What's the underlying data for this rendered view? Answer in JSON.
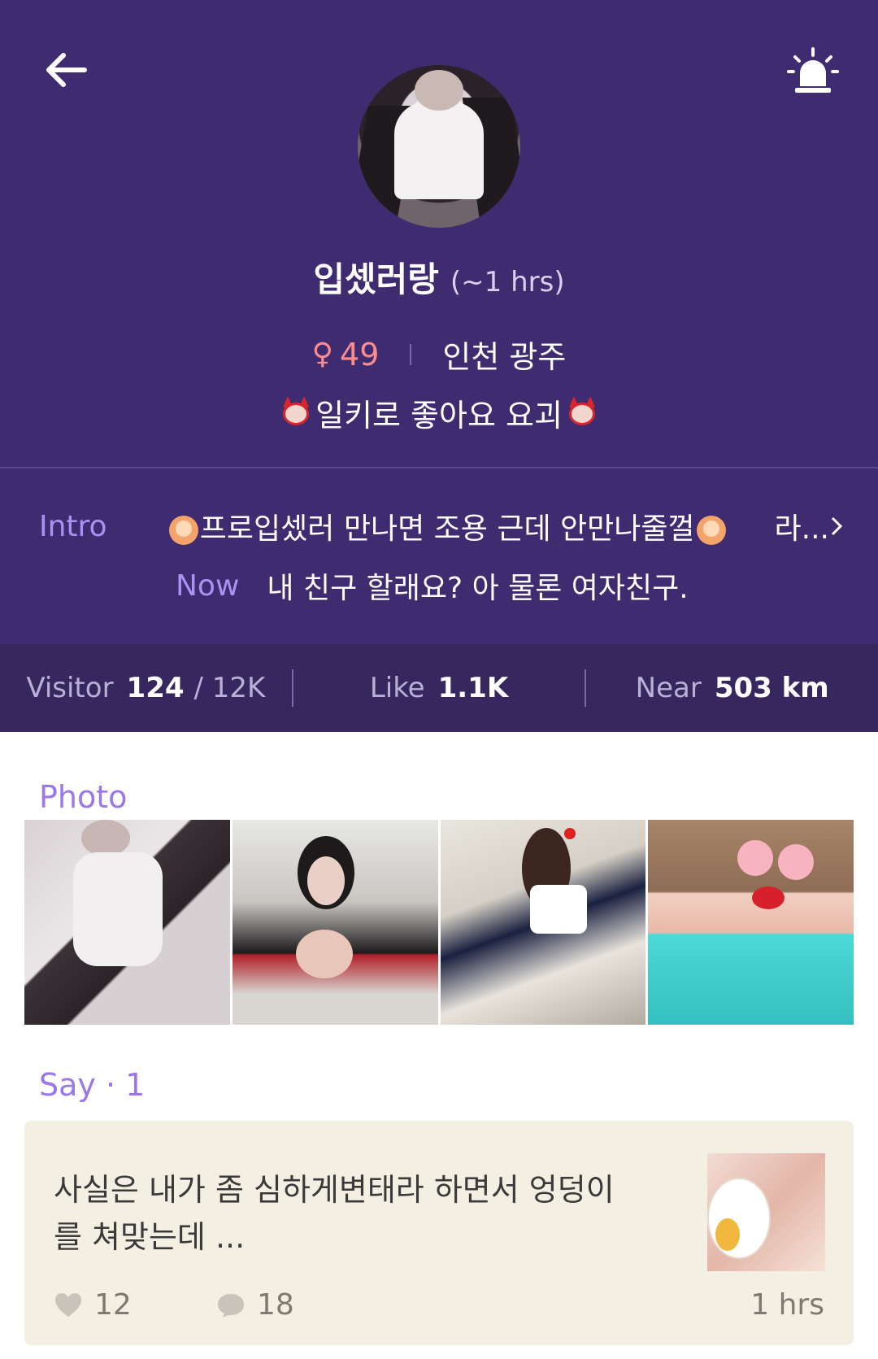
{
  "header": {
    "name": "입셌러랑",
    "last_seen": "(~1 hrs)",
    "age": "49",
    "location": "인천 광주",
    "status": "일키로 좋아요 요괴"
  },
  "intro": {
    "intro_label": "Intro",
    "intro_text": "프로입셌러 만나면 조용 근데 안만나줄껄",
    "intro_more": "라...",
    "now_label": "Now",
    "now_text": "내 친구 할래요? 아 물론 여자친구."
  },
  "stats": {
    "visitor_label": "Visitor",
    "visitor_value": "124",
    "visitor_sub": "/ 12K",
    "like_label": "Like",
    "like_value": "1.1K",
    "near_label": "Near",
    "near_value": "503 km"
  },
  "photos": {
    "title": "Photo",
    "count": 4
  },
  "say": {
    "title": "Say · 1",
    "post_text": "사실은 내가 좀 심하게변태라 하면서 엉덩이를 쳐맞는데 ...",
    "likes": "12",
    "comments": "18",
    "time": "1 hrs"
  },
  "colors": {
    "header_bg": "#3e2b70",
    "stats_bg": "#37275f",
    "accent_purple": "#9a78e8",
    "age_pink": "#ff8c8c",
    "card_bg": "#f4efe3"
  },
  "icons": {
    "back": "arrow-left-icon",
    "alarm": "siren-icon",
    "gender": "female-icon",
    "status_emoji": "devil-icon",
    "intro_emoji": "raising-hand-icon",
    "chevron": "chevron-right-icon",
    "like": "heart-icon",
    "comment": "speech-bubble-icon"
  }
}
